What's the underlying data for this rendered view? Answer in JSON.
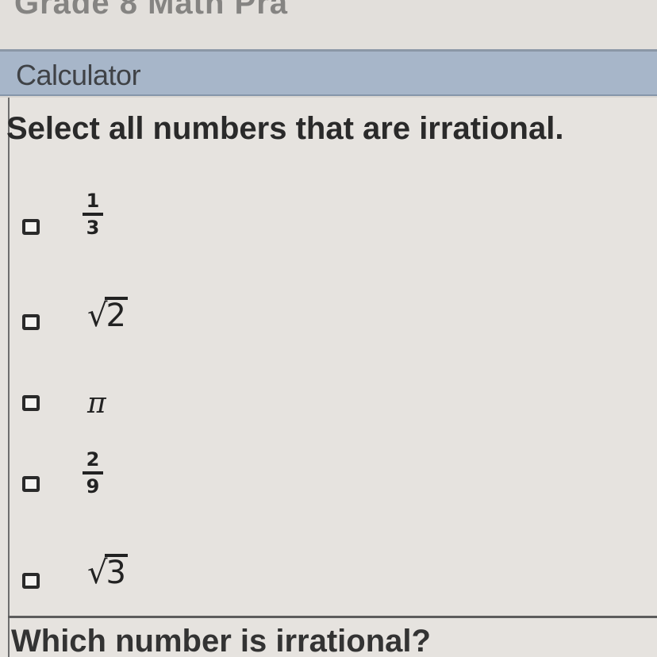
{
  "header": {
    "cut_text": "Grade 8 Math Pra",
    "calculator_label": "Calculator"
  },
  "question": {
    "prompt": "Select all numbers that are irrational.",
    "options": [
      {
        "id": "opt1",
        "type": "fraction",
        "numerator": "1",
        "denominator": "3",
        "checked": false
      },
      {
        "id": "opt2",
        "type": "sqrt",
        "radicand": "2",
        "checked": false
      },
      {
        "id": "opt3",
        "type": "symbol",
        "symbol": "π",
        "checked": false
      },
      {
        "id": "opt4",
        "type": "fraction",
        "numerator": "2",
        "denominator": "9",
        "checked": false
      },
      {
        "id": "opt5",
        "type": "sqrt",
        "radicand": "3",
        "checked": false
      }
    ]
  },
  "next_question": {
    "prompt": "Which number is irrational?"
  },
  "colors": {
    "calc_bar": "#a7b6c9",
    "panel": "#e6e3df",
    "text": "#2a2a2a"
  }
}
